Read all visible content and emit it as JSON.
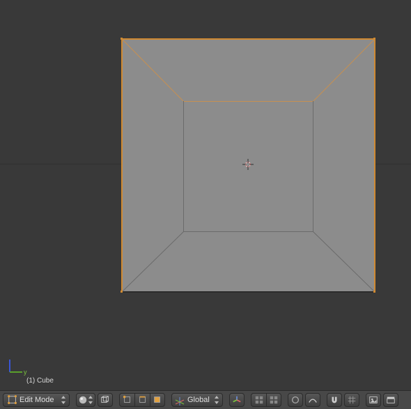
{
  "viewport": {
    "object_label": "(1) Cube"
  },
  "axis": {
    "y_label": "y"
  },
  "header": {
    "mode": "Edit Mode",
    "orientation": "Global"
  }
}
